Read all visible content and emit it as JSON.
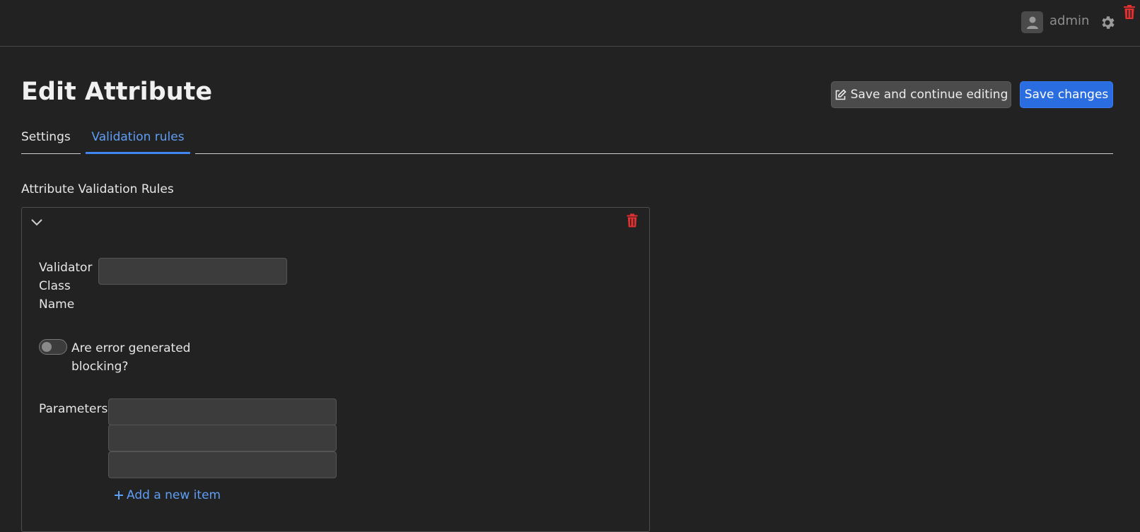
{
  "header": {
    "username": "admin",
    "avatar_icon": "user-icon",
    "settings_icon": "gear-icon",
    "trash_icon": "trash-icon"
  },
  "page": {
    "title": "Edit Attribute",
    "save_continue_label": "Save and continue editing",
    "save_changes_label": "Save changes"
  },
  "tabs": [
    {
      "label": "Settings",
      "active": false
    },
    {
      "label": "Validation rules",
      "active": true
    }
  ],
  "section": {
    "label": "Attribute Validation Rules"
  },
  "rule": {
    "validator_label": "Validator Class Name",
    "validator_value": "",
    "blocking_label": "Are error generated blocking?",
    "blocking_on": false,
    "parameters_label": "Parameters",
    "parameters": [
      "",
      "",
      ""
    ],
    "add_item_label": "Add a new item"
  },
  "colors": {
    "background": "#222222",
    "primary": "#2a6de0",
    "link": "#5e9ef5",
    "danger": "#e03030"
  }
}
